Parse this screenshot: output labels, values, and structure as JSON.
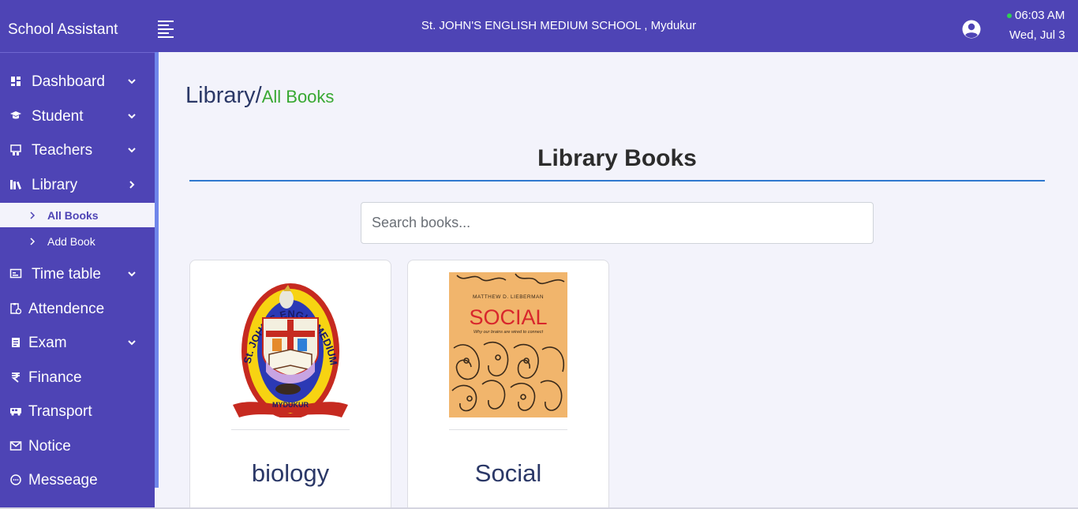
{
  "app": {
    "brand": "School Assistant"
  },
  "header": {
    "school_name": "St. JOHN'S ENGLISH MEDIUM SCHOOL , Mydukur",
    "time": "06:03 AM",
    "date": "Wed, Jul 3",
    "status_color": "#2fd152"
  },
  "sidebar": {
    "items": [
      {
        "label": "Dashboard",
        "icon": "dashboard-icon",
        "chevron": "down"
      },
      {
        "label": "Student",
        "icon": "student-icon",
        "chevron": "down"
      },
      {
        "label": "Teachers",
        "icon": "teachers-icon",
        "chevron": "down"
      },
      {
        "label": "Library",
        "icon": "library-icon",
        "chevron": "right"
      },
      {
        "label": "Time table",
        "icon": "timetable-icon",
        "chevron": "down"
      },
      {
        "label": "Attendence",
        "icon": "attendance-icon"
      },
      {
        "label": "Exam",
        "icon": "exam-icon",
        "chevron": "down"
      },
      {
        "label": "Finance",
        "icon": "rupee-icon"
      },
      {
        "label": "Transport",
        "icon": "bus-icon"
      },
      {
        "label": "Notice",
        "icon": "mail-icon"
      },
      {
        "label": "Messeage",
        "icon": "chat-icon"
      }
    ],
    "library_sub": [
      {
        "label": "All Books",
        "active": true
      },
      {
        "label": "Add Book",
        "active": false
      }
    ]
  },
  "breadcrumb": {
    "main": "Library/",
    "sub": "All Books"
  },
  "section": {
    "title": "Library Books"
  },
  "search": {
    "placeholder": "Search books...",
    "value": ""
  },
  "books": [
    {
      "title": "biology",
      "cover": "school-logo"
    },
    {
      "title": "Social",
      "cover": "social-book-cover"
    }
  ],
  "cover_text": {
    "school_logo": {
      "arc_left": "St. JOHN'S ENGLI",
      "arc_right": "MEDIUM SCHOOL",
      "place": "MYDUKUR"
    },
    "social_book": {
      "author": "MATTHEW D. LIEBERMAN",
      "title": "SOCIAL",
      "subtitle": "Why our brains are wired to connect"
    }
  },
  "colors": {
    "primary": "#4e44b5",
    "accent_green": "#38a832",
    "heading_navy": "#2b3867",
    "rule_blue": "#2f78cf"
  }
}
